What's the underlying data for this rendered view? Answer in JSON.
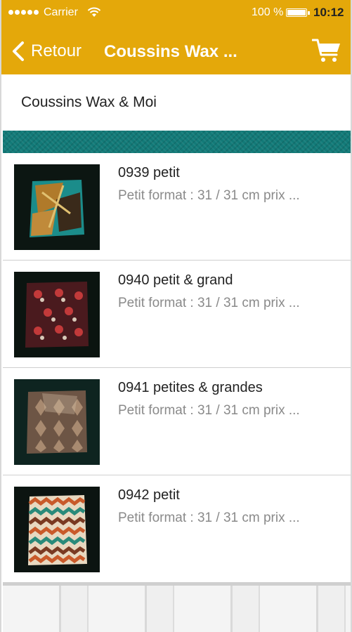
{
  "status_bar": {
    "carrier": "Carrier",
    "battery_percent": "100 %",
    "time": "10:12"
  },
  "nav": {
    "back_label": "Retour",
    "title": "Coussins Wax ...",
    "cart_icon": "cart-icon"
  },
  "header": {
    "shop_name": "Coussins Wax & Moi"
  },
  "products": [
    {
      "title": "0939 petit",
      "description": "Petit format : 31 / 31 cm prix ...",
      "thumb_colors": [
        "#1b8c8a",
        "#b07a2a",
        "#3a2a1a"
      ]
    },
    {
      "title": "0940 petit & grand",
      "description": "Petit format : 31 / 31 cm prix ...",
      "thumb_colors": [
        "#4a1a1e",
        "#c23a3a",
        "#d8c9b8"
      ]
    },
    {
      "title": "0941 petites & grandes",
      "description": "Petit format : 31 / 31 cm prix ...",
      "thumb_colors": [
        "#6d5545",
        "#a88a70",
        "#d6c3a8"
      ]
    },
    {
      "title": "0942 petit",
      "description": "Petit format : 31 / 31 cm prix ...",
      "thumb_colors": [
        "#2a8a7a",
        "#c95a2a",
        "#e8d8c0"
      ]
    }
  ],
  "colors": {
    "nav_background": "#e4a80a",
    "banner": "#127a78"
  }
}
